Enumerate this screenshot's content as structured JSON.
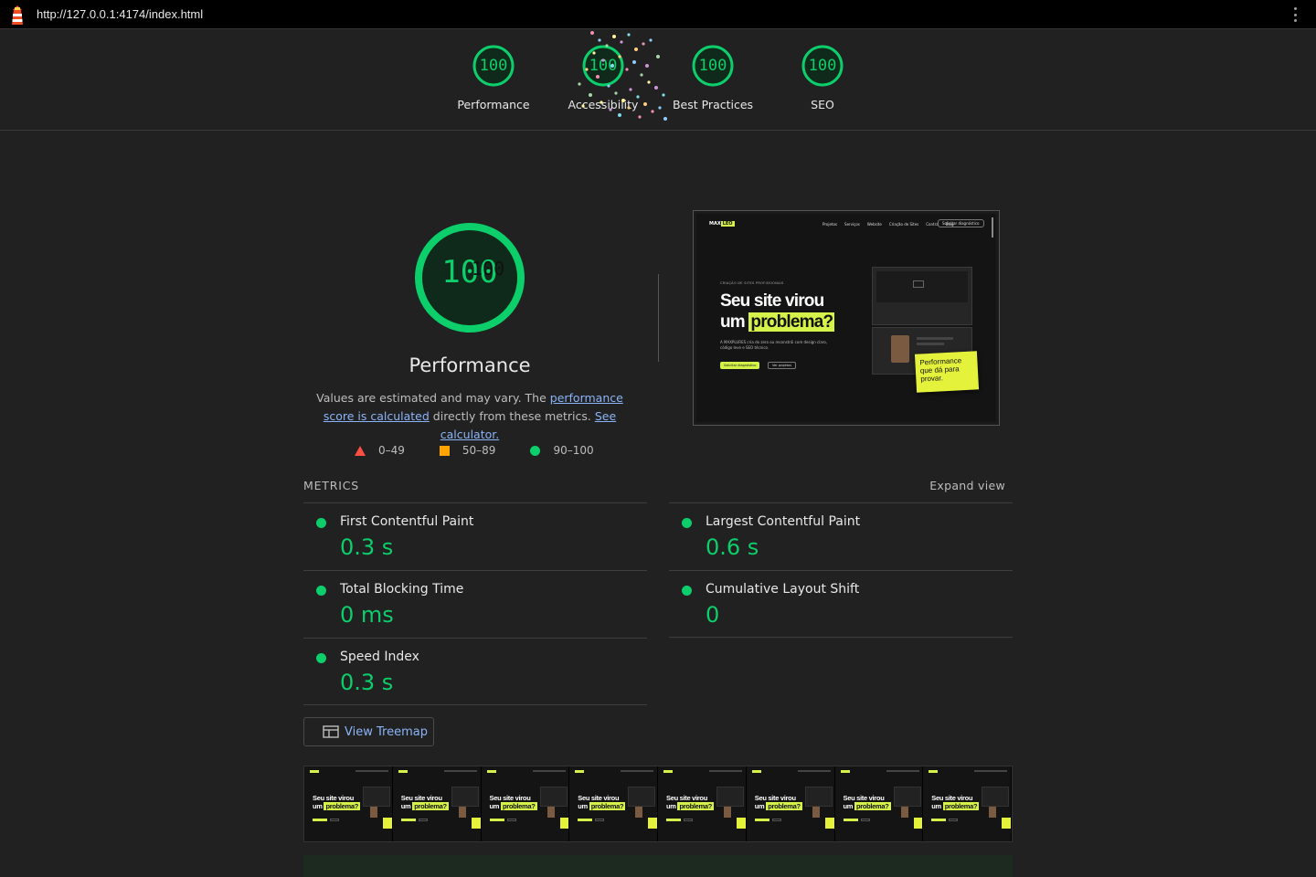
{
  "browser": {
    "url": "http://127.0.0.1:4174/index.html"
  },
  "header_scores": [
    {
      "score": "100",
      "label": "Performance"
    },
    {
      "score": "100",
      "label": "Accessibility"
    },
    {
      "score": "100",
      "label": "Best Practices"
    },
    {
      "score": "100",
      "label": "SEO"
    }
  ],
  "performance": {
    "score": "100",
    "score_overlay": "100",
    "title": "Performance",
    "desc_prefix": "Values are estimated and may vary. The ",
    "desc_link1": "performance score is calculated",
    "desc_mid": " directly from these metrics. ",
    "desc_link2": "See calculator."
  },
  "legend": {
    "fail": "0–49",
    "average": "50–89",
    "pass": "90–100"
  },
  "metrics": {
    "label": "METRICS",
    "expand": "Expand view",
    "items": [
      {
        "name": "First Contentful Paint",
        "value": "0.3 s"
      },
      {
        "name": "Largest Contentful Paint",
        "value": "0.6 s"
      },
      {
        "name": "Total Blocking Time",
        "value": "0 ms"
      },
      {
        "name": "Cumulative Layout Shift",
        "value": "0"
      },
      {
        "name": "Speed Index",
        "value": "0.3 s"
      }
    ]
  },
  "treemap": {
    "label": "View Treemap"
  },
  "preview": {
    "logo_text": "MAX",
    "logo_badge": "LEO",
    "nav": [
      "Projetos",
      "Serviços",
      "Website",
      "Criação de Sites",
      "Contra",
      "Blog"
    ],
    "cta": "Solicitar diagnóstico",
    "kicker": "CRIAÇÃO DE SITES PROFISSIONAIS",
    "headline_1": "Seu site virou",
    "headline_2a": "um ",
    "headline_2b": "problema?",
    "paragraph": "A MAXPLURES cria do zero ou reconstrói com design claro, código leve e SEO técnico.",
    "button_primary": "Solicitar diagnóstico",
    "button_secondary": "Ver projetos",
    "sticky_note": "Performance que dá para provar."
  },
  "colors": {
    "pass": "#0cce6b",
    "average": "#ffa400",
    "fail": "#ff4e42",
    "link": "#8ab4f8",
    "accent_site": "#d4f24a"
  }
}
